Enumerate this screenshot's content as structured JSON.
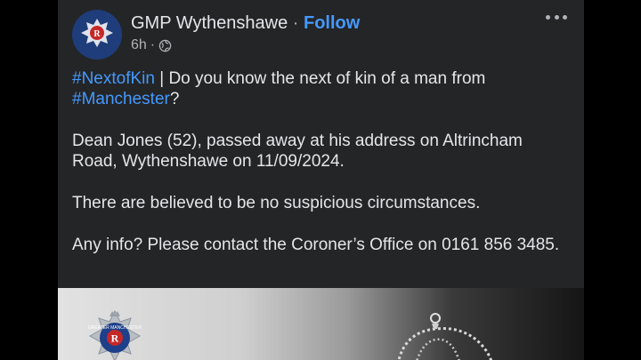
{
  "post": {
    "page_name": "GMP Wythenshawe",
    "separator": "·",
    "follow_label": "Follow",
    "time": "6h",
    "dot": "·",
    "paragraphs": {
      "p1": {
        "hashtag1": "#NextofKin",
        "text1": " | Do you know the next of kin of a man from ",
        "hashtag2": "#Manchester",
        "text2": "?"
      },
      "p2": "Dean Jones (52), passed away at his address on Altrincham Road, Wythenshawe on 11/09/2024.",
      "p3": "There are believed to be no suspicious circumstances.",
      "p4": "Any info? Please contact the Coroner’s Office on 0161 856 3485."
    },
    "image": {
      "badge_text": "GREATER MANCHESTER"
    }
  },
  "colors": {
    "background": "#000000",
    "card": "#242526",
    "text": "#e4e6eb",
    "link": "#4599ff",
    "muted": "#b0b3b8"
  },
  "icons": [
    "police-crest-icon",
    "globe-icon",
    "more-options-icon",
    "crown-icon"
  ]
}
